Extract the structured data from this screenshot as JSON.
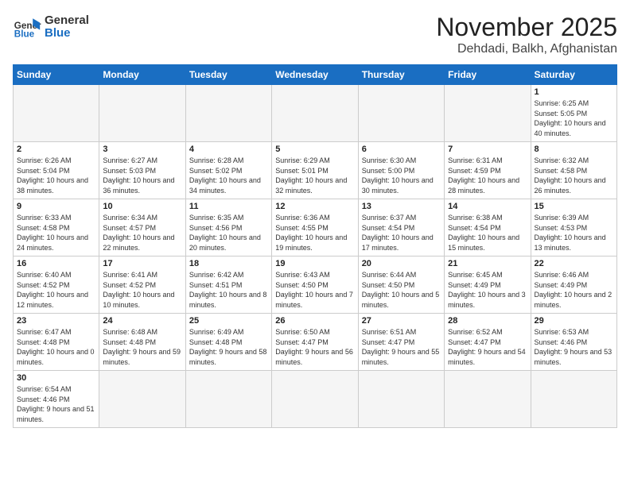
{
  "logo": {
    "text_general": "General",
    "text_blue": "Blue"
  },
  "header": {
    "month": "November 2025",
    "location": "Dehdadi, Balkh, Afghanistan"
  },
  "weekdays": [
    "Sunday",
    "Monday",
    "Tuesday",
    "Wednesday",
    "Thursday",
    "Friday",
    "Saturday"
  ],
  "days": [
    {
      "date": "",
      "info": ""
    },
    {
      "date": "",
      "info": ""
    },
    {
      "date": "",
      "info": ""
    },
    {
      "date": "",
      "info": ""
    },
    {
      "date": "",
      "info": ""
    },
    {
      "date": "",
      "info": ""
    },
    {
      "date": "1",
      "info": "Sunrise: 6:25 AM\nSunset: 5:05 PM\nDaylight: 10 hours and 40 minutes."
    },
    {
      "date": "2",
      "info": "Sunrise: 6:26 AM\nSunset: 5:04 PM\nDaylight: 10 hours and 38 minutes."
    },
    {
      "date": "3",
      "info": "Sunrise: 6:27 AM\nSunset: 5:03 PM\nDaylight: 10 hours and 36 minutes."
    },
    {
      "date": "4",
      "info": "Sunrise: 6:28 AM\nSunset: 5:02 PM\nDaylight: 10 hours and 34 minutes."
    },
    {
      "date": "5",
      "info": "Sunrise: 6:29 AM\nSunset: 5:01 PM\nDaylight: 10 hours and 32 minutes."
    },
    {
      "date": "6",
      "info": "Sunrise: 6:30 AM\nSunset: 5:00 PM\nDaylight: 10 hours and 30 minutes."
    },
    {
      "date": "7",
      "info": "Sunrise: 6:31 AM\nSunset: 4:59 PM\nDaylight: 10 hours and 28 minutes."
    },
    {
      "date": "8",
      "info": "Sunrise: 6:32 AM\nSunset: 4:58 PM\nDaylight: 10 hours and 26 minutes."
    },
    {
      "date": "9",
      "info": "Sunrise: 6:33 AM\nSunset: 4:58 PM\nDaylight: 10 hours and 24 minutes."
    },
    {
      "date": "10",
      "info": "Sunrise: 6:34 AM\nSunset: 4:57 PM\nDaylight: 10 hours and 22 minutes."
    },
    {
      "date": "11",
      "info": "Sunrise: 6:35 AM\nSunset: 4:56 PM\nDaylight: 10 hours and 20 minutes."
    },
    {
      "date": "12",
      "info": "Sunrise: 6:36 AM\nSunset: 4:55 PM\nDaylight: 10 hours and 19 minutes."
    },
    {
      "date": "13",
      "info": "Sunrise: 6:37 AM\nSunset: 4:54 PM\nDaylight: 10 hours and 17 minutes."
    },
    {
      "date": "14",
      "info": "Sunrise: 6:38 AM\nSunset: 4:54 PM\nDaylight: 10 hours and 15 minutes."
    },
    {
      "date": "15",
      "info": "Sunrise: 6:39 AM\nSunset: 4:53 PM\nDaylight: 10 hours and 13 minutes."
    },
    {
      "date": "16",
      "info": "Sunrise: 6:40 AM\nSunset: 4:52 PM\nDaylight: 10 hours and 12 minutes."
    },
    {
      "date": "17",
      "info": "Sunrise: 6:41 AM\nSunset: 4:52 PM\nDaylight: 10 hours and 10 minutes."
    },
    {
      "date": "18",
      "info": "Sunrise: 6:42 AM\nSunset: 4:51 PM\nDaylight: 10 hours and 8 minutes."
    },
    {
      "date": "19",
      "info": "Sunrise: 6:43 AM\nSunset: 4:50 PM\nDaylight: 10 hours and 7 minutes."
    },
    {
      "date": "20",
      "info": "Sunrise: 6:44 AM\nSunset: 4:50 PM\nDaylight: 10 hours and 5 minutes."
    },
    {
      "date": "21",
      "info": "Sunrise: 6:45 AM\nSunset: 4:49 PM\nDaylight: 10 hours and 3 minutes."
    },
    {
      "date": "22",
      "info": "Sunrise: 6:46 AM\nSunset: 4:49 PM\nDaylight: 10 hours and 2 minutes."
    },
    {
      "date": "23",
      "info": "Sunrise: 6:47 AM\nSunset: 4:48 PM\nDaylight: 10 hours and 0 minutes."
    },
    {
      "date": "24",
      "info": "Sunrise: 6:48 AM\nSunset: 4:48 PM\nDaylight: 9 hours and 59 minutes."
    },
    {
      "date": "25",
      "info": "Sunrise: 6:49 AM\nSunset: 4:48 PM\nDaylight: 9 hours and 58 minutes."
    },
    {
      "date": "26",
      "info": "Sunrise: 6:50 AM\nSunset: 4:47 PM\nDaylight: 9 hours and 56 minutes."
    },
    {
      "date": "27",
      "info": "Sunrise: 6:51 AM\nSunset: 4:47 PM\nDaylight: 9 hours and 55 minutes."
    },
    {
      "date": "28",
      "info": "Sunrise: 6:52 AM\nSunset: 4:47 PM\nDaylight: 9 hours and 54 minutes."
    },
    {
      "date": "29",
      "info": "Sunrise: 6:53 AM\nSunset: 4:46 PM\nDaylight: 9 hours and 53 minutes."
    },
    {
      "date": "30",
      "info": "Sunrise: 6:54 AM\nSunset: 4:46 PM\nDaylight: 9 hours and 51 minutes."
    }
  ]
}
